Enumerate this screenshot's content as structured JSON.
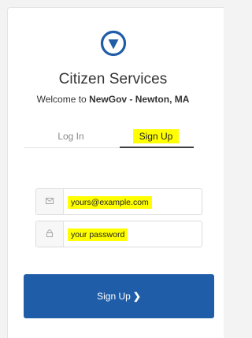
{
  "header": {
    "logo_icon": "location-arrow-circle-icon",
    "logo_color": "#1f5da8",
    "title": "Citizen Services",
    "welcome_prefix": "Welcome to ",
    "welcome_org": "NewGov - Newton, MA"
  },
  "tabs": {
    "login_label": "Log In",
    "signup_label": "Sign Up",
    "active": "Sign Up"
  },
  "form": {
    "email": {
      "icon": "envelope-icon",
      "placeholder": "yours@example.com"
    },
    "password": {
      "icon": "lock-icon",
      "placeholder": "your password"
    }
  },
  "submit": {
    "label": "Sign Up",
    "chevron": "❯",
    "color": "#1f5da8"
  },
  "highlight_color": "#ffff00"
}
